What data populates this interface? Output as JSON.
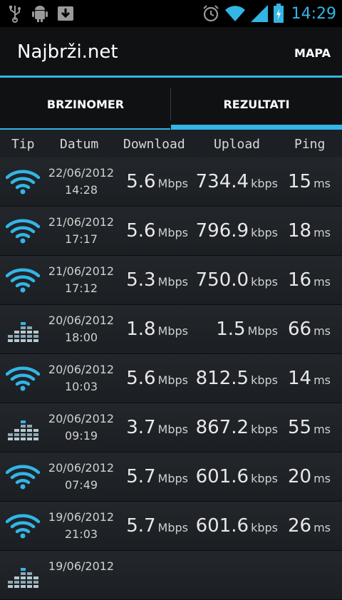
{
  "status_bar": {
    "time": "14:29",
    "left_icons": [
      "usb-icon",
      "android-icon",
      "download-icon"
    ],
    "right_icons": [
      "alarm-icon",
      "wifi-icon",
      "signal-icon",
      "battery-icon"
    ]
  },
  "action_bar": {
    "title": "Najbrži.net",
    "action_label": "MAPA"
  },
  "tabs": [
    {
      "label": "BRZINOMER",
      "selected": false
    },
    {
      "label": "REZULTATI",
      "selected": true
    }
  ],
  "columns": {
    "type": "Tip",
    "date": "Datum",
    "download": "Download",
    "upload": "Upload",
    "ping": "Ping"
  },
  "accent_color": "#33b5e5",
  "rows": [
    {
      "type_icon": "wifi-icon",
      "date": "22/06/2012",
      "time": "14:28",
      "download": "5.6",
      "download_unit": "Mbps",
      "upload": "734.4",
      "upload_unit": "kbps",
      "ping": "15",
      "ping_unit": "ms"
    },
    {
      "type_icon": "wifi-icon",
      "date": "21/06/2012",
      "time": "17:17",
      "download": "5.6",
      "download_unit": "Mbps",
      "upload": "796.9",
      "upload_unit": "kbps",
      "ping": "18",
      "ping_unit": "ms"
    },
    {
      "type_icon": "wifi-icon",
      "date": "21/06/2012",
      "time": "17:12",
      "download": "5.3",
      "download_unit": "Mbps",
      "upload": "750.0",
      "upload_unit": "kbps",
      "ping": "16",
      "ping_unit": "ms"
    },
    {
      "type_icon": "mobile-data-icon",
      "date": "20/06/2012",
      "time": "18:00",
      "download": "1.8",
      "download_unit": "Mbps",
      "upload": "1.5",
      "upload_unit": "Mbps",
      "ping": "66",
      "ping_unit": "ms"
    },
    {
      "type_icon": "wifi-icon",
      "date": "20/06/2012",
      "time": "10:03",
      "download": "5.6",
      "download_unit": "Mbps",
      "upload": "812.5",
      "upload_unit": "kbps",
      "ping": "14",
      "ping_unit": "ms"
    },
    {
      "type_icon": "mobile-data-icon",
      "date": "20/06/2012",
      "time": "09:19",
      "download": "3.7",
      "download_unit": "Mbps",
      "upload": "867.2",
      "upload_unit": "kbps",
      "ping": "55",
      "ping_unit": "ms"
    },
    {
      "type_icon": "wifi-icon",
      "date": "20/06/2012",
      "time": "07:49",
      "download": "5.7",
      "download_unit": "Mbps",
      "upload": "601.6",
      "upload_unit": "kbps",
      "ping": "20",
      "ping_unit": "ms"
    },
    {
      "type_icon": "wifi-icon",
      "date": "19/06/2012",
      "time": "21:03",
      "download": "5.7",
      "download_unit": "Mbps",
      "upload": "601.6",
      "upload_unit": "kbps",
      "ping": "26",
      "ping_unit": "ms"
    },
    {
      "type_icon": "mobile-data-icon",
      "date": "19/06/2012",
      "time": "",
      "download": "",
      "download_unit": "",
      "upload": "",
      "upload_unit": "",
      "ping": "",
      "ping_unit": ""
    }
  ]
}
